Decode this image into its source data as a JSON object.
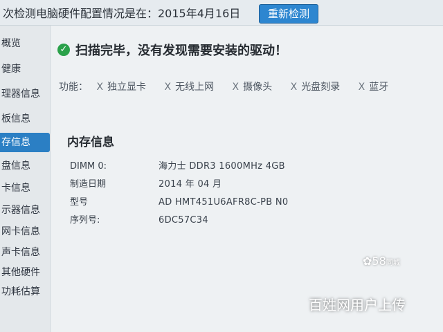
{
  "topbar": {
    "message": "次检测电脑硬件配置情况是在：2015年4月16日",
    "recheck_label": "重新检测"
  },
  "sidebar": {
    "items": [
      {
        "label": "概览"
      },
      {
        "label": "健康"
      },
      {
        "label": "理器信息"
      },
      {
        "label": "板信息"
      },
      {
        "label": "存信息",
        "active": true
      },
      {
        "label": "盘信息"
      },
      {
        "label": "卡信息"
      },
      {
        "label": "示器信息"
      },
      {
        "label": "网卡信息"
      },
      {
        "label": "声卡信息"
      },
      {
        "label": "其他硬件"
      },
      {
        "label": "功耗估算"
      }
    ]
  },
  "status": {
    "icon": "check-circle-icon",
    "color": "#2aa14a",
    "text": "扫描完毕，没有发现需要安装的驱动！"
  },
  "features": {
    "label": "功能：",
    "items": [
      "独立显卡",
      "无线上网",
      "摄像头",
      "光盘刻录",
      "蓝牙"
    ],
    "mark": "X"
  },
  "memory": {
    "title": "内存信息",
    "rows": [
      {
        "key": "DIMM 0:",
        "value": "海力士 DDR3 1600MHz 4GB"
      },
      {
        "key": "制造日期",
        "value": "2014 年 04 月"
      },
      {
        "key": "型号",
        "value": "AD HMT451U6AFR8C-PB  N0"
      },
      {
        "key": "序列号:",
        "value": "6DC57C34"
      }
    ]
  },
  "watermark": {
    "logo": "58",
    "logo_sub": "同城",
    "upload": "百姓网用户上传"
  },
  "colors": {
    "accent": "#2b7fc4",
    "button": "#2d86d0"
  }
}
